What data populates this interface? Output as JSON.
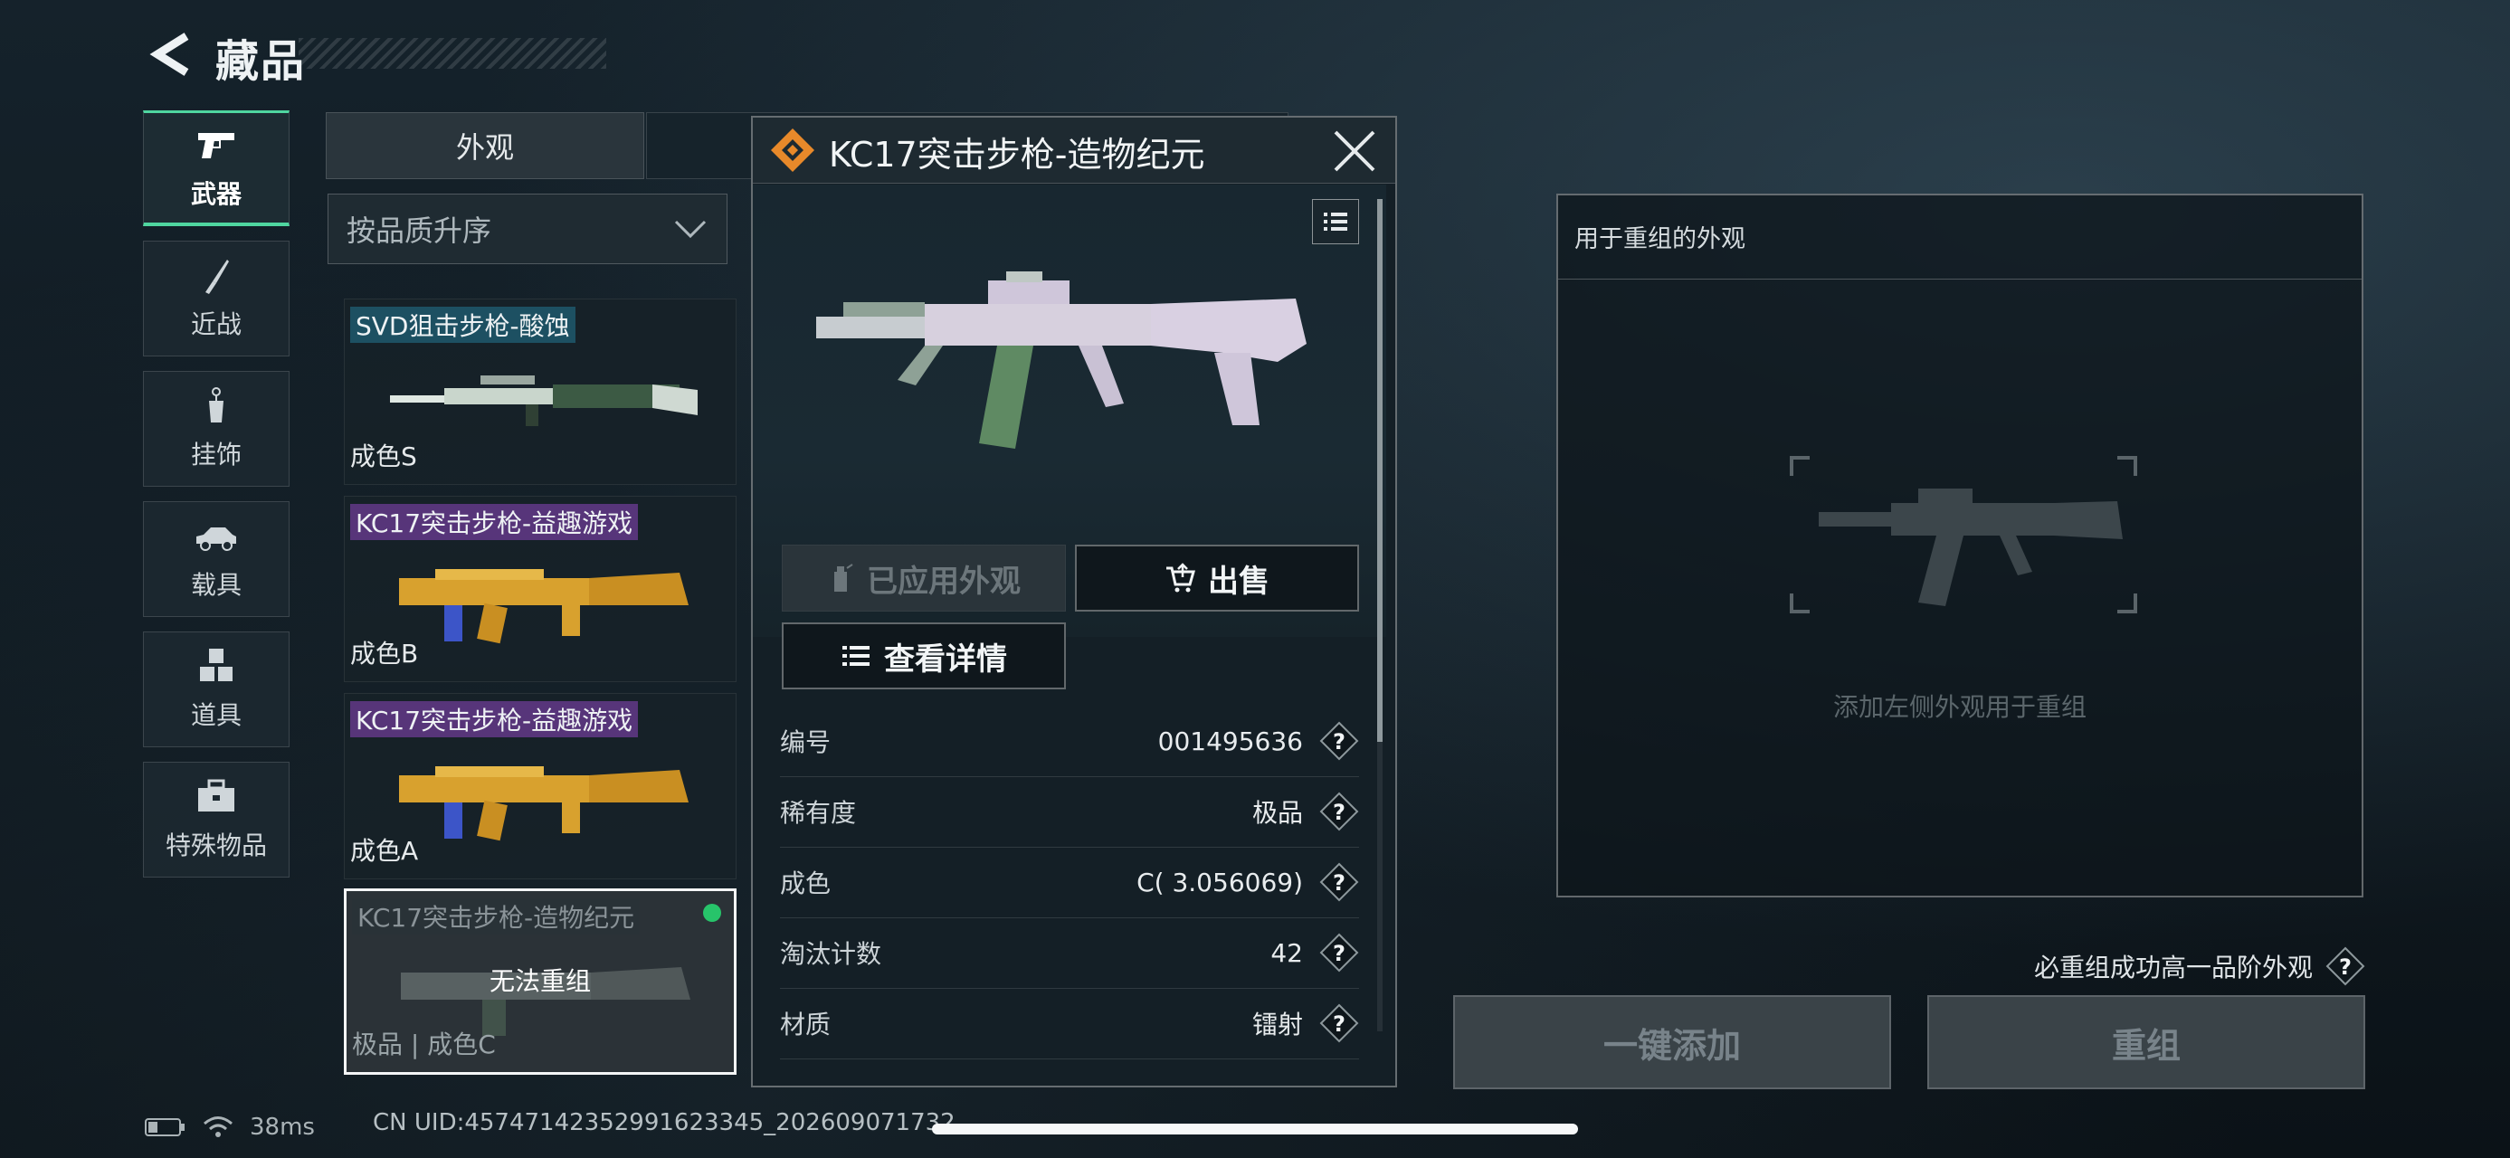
{
  "header": {
    "title": "藏品"
  },
  "nav": [
    {
      "label": "武器",
      "icon": "pistol-icon",
      "active": true
    },
    {
      "label": "近战",
      "icon": "knife-icon"
    },
    {
      "label": "挂饰",
      "icon": "charm-icon"
    },
    {
      "label": "载具",
      "icon": "car-icon"
    },
    {
      "label": "道具",
      "icon": "cubes-icon"
    },
    {
      "label": "特殊物品",
      "icon": "toolbox-icon"
    }
  ],
  "tabs": {
    "appearance": "外观"
  },
  "sort": {
    "label": "按品质升序"
  },
  "skins": [
    {
      "name": "SVD狙击步枪-酸蚀",
      "grade": "成色S"
    },
    {
      "name": "KC17突击步枪-益趣游戏",
      "grade": "成色B"
    },
    {
      "name": "KC17突击步枪-益趣游戏",
      "grade": "成色A"
    },
    {
      "name": "KC17突击步枪-造物纪元",
      "grade": "极品 | 成色C",
      "overlay": "无法重组",
      "status": "equipped"
    }
  ],
  "detail": {
    "title": "KC17突击步枪-造物纪元",
    "applied_label": "已应用外观",
    "sell_label": "出售",
    "view_detail_label": "查看详情",
    "attributes": [
      {
        "label": "编号",
        "value": "001495636"
      },
      {
        "label": "稀有度",
        "value": "极品"
      },
      {
        "label": "成色",
        "value": "C( 3.056069)"
      },
      {
        "label": "淘汰计数",
        "value": "42"
      },
      {
        "label": "材质",
        "value": "镭射"
      }
    ]
  },
  "remake": {
    "panel_title": "用于重组的外观",
    "hint": "添加左侧外观用于重组",
    "must_note": "必重组成功高一品阶外观",
    "one_key_add": "一键添加",
    "remake_button": "重组"
  },
  "status_bar": {
    "ping": "38ms",
    "uid": "CN UID:45747142352991623345_202609071732"
  },
  "colors": {
    "accent_green": "#4fd6a0",
    "orange_rarity": "#e8892a",
    "status_green": "#27c46a"
  }
}
